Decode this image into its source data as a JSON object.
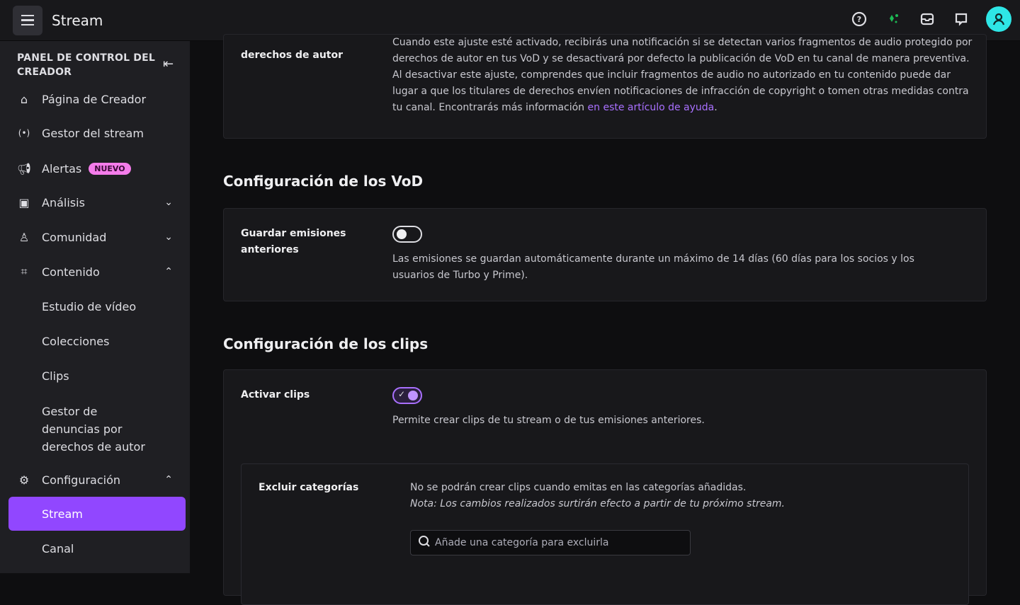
{
  "topbar": {
    "title": "Stream",
    "icons": [
      "help-icon",
      "crown-sparkle-icon",
      "inbox-icon",
      "whispers-icon",
      "avatar-icon"
    ],
    "accent": "#9147ff"
  },
  "sidebar": {
    "heading": "PANEL DE CONTROL DEL CREADOR",
    "items": [
      {
        "label": "Página de Creador",
        "icon": "home-icon"
      },
      {
        "label": "Gestor del stream",
        "icon": "broadcast-icon"
      },
      {
        "label": "Alertas",
        "icon": "megaphone-icon",
        "badge": "NUEVO"
      },
      {
        "label": "Análisis",
        "icon": "analytics-icon",
        "chevron": "down"
      },
      {
        "label": "Comunidad",
        "icon": "community-icon",
        "chevron": "down"
      },
      {
        "label": "Contenido",
        "icon": "content-icon",
        "chevron": "up"
      },
      {
        "label": "Estudio de vídeo"
      },
      {
        "label": "Colecciones"
      },
      {
        "label": "Clips"
      },
      {
        "label": "Gestor de denuncias por derechos de autor"
      },
      {
        "label": "Configuración",
        "icon": "gear-icon",
        "chevron": "up"
      },
      {
        "label": "Stream",
        "active": true
      },
      {
        "label": "Canal"
      }
    ]
  },
  "main": {
    "copyright": {
      "label": "derechos de autor",
      "desc": "Cuando este ajuste esté activado, recibirás una notificación si se detectan varios fragmentos de audio protegido por derechos de autor en tus VoD y se desactivará por defecto la publicación de VoD en tu canal de manera preventiva. Al desactivar este ajuste, comprendes que incluir fragmentos de audio no autorizado en tu contenido puede dar lugar a que los titulares de derechos envíen notificaciones de infracción de copyright o tomen otras medidas contra tu canal. Encontrarás más información ",
      "link": "en este artículo de ayuda",
      "tail": "."
    },
    "vod": {
      "heading": "Configuración de los VoD",
      "label": "Guardar emisiones anteriores",
      "toggle": false,
      "desc": "Las emisiones se guardan automáticamente durante un máximo de 14 días (60 días para los socios y los usuarios de Turbo y Prime)."
    },
    "clips": {
      "heading": "Configuración de los clips",
      "label": "Activar clips",
      "toggle": true,
      "desc": "Permite crear clips de tu stream o de tus emisiones anteriores.",
      "exclude": {
        "label": "Excluir categorías",
        "desc": "No se podrán crear clips cuando emitas en las categorías añadidas.",
        "note": "Nota: Los cambios realizados surtirán efecto a partir de tu próximo stream.",
        "placeholder": "Añade una categoría para excluirla"
      }
    }
  }
}
